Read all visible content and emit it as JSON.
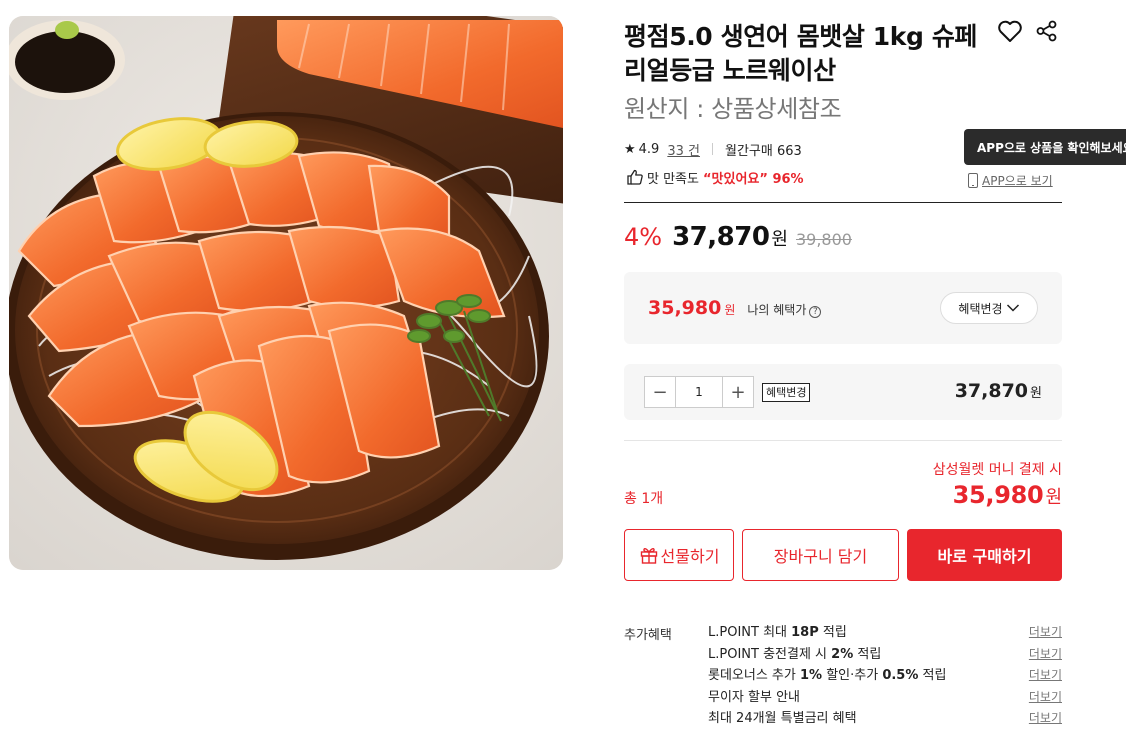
{
  "product": {
    "title": "평점5.0 생연어 몸뱃살 1kg 슈페리얼등급 노르웨이산",
    "origin": "원산지 : 상품상세참조",
    "image_alt": "연어 회 플레이트"
  },
  "rating": {
    "score": "4.9",
    "review_count": "33 건",
    "monthly_purchase": "월간구매 663"
  },
  "taste": {
    "label": "맛 만족도",
    "value": "“맛있어요” 96%"
  },
  "app": {
    "tooltip": "APP으로 상품을 확인해보세요",
    "link_label": "APP으로 보기"
  },
  "price": {
    "discount_rate": "4%",
    "sale_price": "37,870",
    "unit": "원",
    "original_price": "39,800"
  },
  "benefit": {
    "amount": "35,980",
    "unit": "원",
    "label": "나의 혜택가",
    "change_button": "혜택변경"
  },
  "quantity": {
    "minus": "−",
    "value": "1",
    "plus": "+",
    "benefit_tag": "혜택변경",
    "price": "37,870",
    "unit": "원"
  },
  "summary": {
    "pay_note": "삼성월렛 머니 결제 시",
    "total_count": "총 1개",
    "total_amount": "35,980",
    "unit": "원"
  },
  "actions": {
    "gift": "선물하기",
    "cart": "장바구니 담기",
    "buy": "바로 구매하기"
  },
  "extra_benefits": {
    "label": "추가혜택",
    "more": "더보기",
    "items": [
      {
        "pre": "L.POINT 최대 ",
        "bold": "18P",
        "post": " 적립"
      },
      {
        "pre": "L.POINT 충전결제 시 ",
        "bold": "2%",
        "post": " 적립"
      },
      {
        "pre": "롯데오너스 추가 ",
        "bold": "1%",
        "mid": " 할인·추가 ",
        "bold2": "0.5%",
        "post": " 적립"
      },
      {
        "pre": "무이자 할부 안내"
      },
      {
        "pre": "최대 24개월 특별금리 혜택"
      }
    ]
  },
  "colors": {
    "accent": "#e8262d",
    "text": "#111111",
    "muted": "#777777",
    "panel": "#f6f6f6"
  }
}
